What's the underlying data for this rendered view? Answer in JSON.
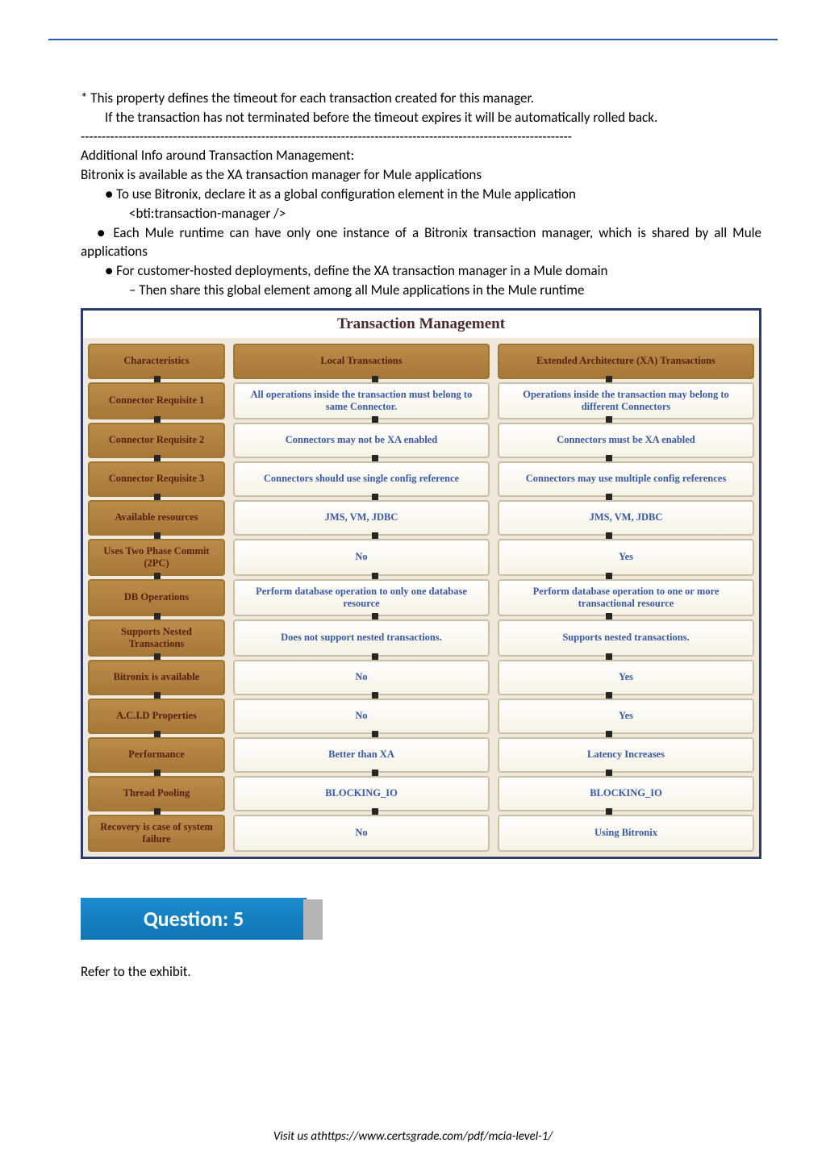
{
  "intro": {
    "line1": "* This property defines the timeout for each transaction created for this manager.",
    "line2": "If the transaction has not terminated before the timeout expires it will be automatically rolled back.",
    "separator": "---------------------------------------------------------------------------------------------------------------------",
    "addl_title": "Additional Info around Transaction Management:",
    "addl_l1": "Bitronix is available as the XA transaction manager for Mule applications",
    "addl_l2": "● To use Bitronix, declare it as a global configuration element in the Mule application",
    "addl_l3": "<bti:transaction-manager />",
    "addl_l4": "● Each Mule runtime can have only one instance of a Bitronix transaction manager, which is shared by all Mule applications",
    "addl_l5": "● For customer-hosted deployments, define the XA transaction manager in a Mule domain",
    "addl_l6": "– Then share this global element among all Mule applications in the Mule runtime"
  },
  "table": {
    "title": "Transaction Management",
    "rows": [
      {
        "c1": "Characteristics",
        "c2": "Local Transactions",
        "c3": "Extended Architecture (XA) Transactions"
      },
      {
        "c1": "Connector Requisite 1",
        "c2": "All operations inside the transaction must belong to same Connector.",
        "c3": "Operations inside the transaction may belong to different Connectors"
      },
      {
        "c1": "Connector Requisite 2",
        "c2": "Connectors may not be XA enabled",
        "c3": "Connectors must be XA enabled"
      },
      {
        "c1": "Connector Requisite 3",
        "c2": "Connectors should use single config reference",
        "c3": "Connectors may use multiple config references"
      },
      {
        "c1": "Available resources",
        "c2": "JMS, VM, JDBC",
        "c3": "JMS, VM, JDBC"
      },
      {
        "c1": "Uses Two Phase Commit (2PC)",
        "c2": "No",
        "c3": "Yes"
      },
      {
        "c1": "DB Operations",
        "c2": "Perform database operation to only one database resource",
        "c3": "Perform database operation to one or more transactional resource"
      },
      {
        "c1": "Supports Nested Transactions",
        "c2": "Does not support nested transactions.",
        "c3": "Supports nested transactions."
      },
      {
        "c1": "Bitronix is available",
        "c2": "No",
        "c3": "Yes"
      },
      {
        "c1": "A.C.I.D Properties",
        "c2": "No",
        "c3": "Yes"
      },
      {
        "c1": "Performance",
        "c2": "Better than XA",
        "c3": "Latency Increases"
      },
      {
        "c1": "Thread Pooling",
        "c2": "BLOCKING_IO",
        "c3": "BLOCKING_IO"
      },
      {
        "c1": "Recovery is case of system failure",
        "c2": "No",
        "c3": "Using Bitronix"
      }
    ]
  },
  "question_banner": "Question: 5",
  "refer_text": "Refer to the exhibit.",
  "footer": "Visit us athttps://www.certsgrade.com/pdf/mcia-level-1/"
}
